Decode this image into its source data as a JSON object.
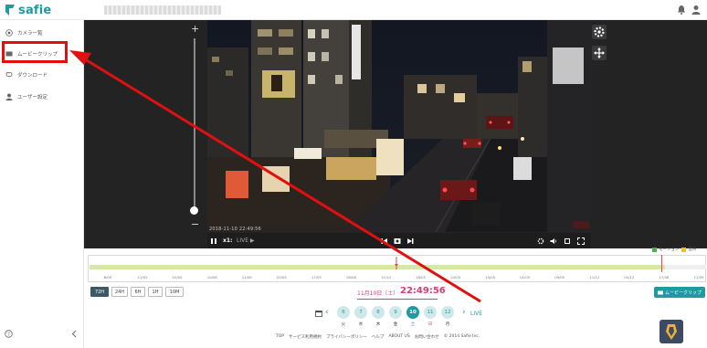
{
  "header": {
    "logo_text": "safie",
    "brand_color": "#1e9aa0"
  },
  "sidebar": {
    "items": [
      {
        "label": "カメラ一覧",
        "icon": "camera-icon"
      },
      {
        "label": "ムービークリップ",
        "icon": "film-icon"
      },
      {
        "label": "ダウンロード",
        "icon": "download-icon"
      },
      {
        "label": "ユーザー設定",
        "icon": "user-icon"
      }
    ],
    "highlight_color": "#e01010"
  },
  "player": {
    "timestamp": "2018-11-10 22:49:56",
    "speed_label": "x1:",
    "live_label": "LIVE ▶",
    "zoom_plus": "+",
    "zoom_minus": "−"
  },
  "timeline": {
    "legend": [
      {
        "label": "モーション",
        "color": "#4caf50"
      },
      {
        "label": "音声",
        "color": "#f0c020"
      }
    ],
    "ticks": [
      "8/09",
      "11/02",
      "10/05",
      "10/08",
      "11/09",
      "20/05",
      "17/05",
      "16/08",
      "11/10",
      "18/05",
      "10/05",
      "14/05",
      "01/05",
      "09/05",
      "11/12",
      "04/12",
      "17/08",
      "11/09"
    ],
    "range_buttons": [
      "72H",
      "24H",
      "6H",
      "1H",
      "10M"
    ],
    "active_range": "72H",
    "current_date": "11月10日（土）",
    "current_time": "22:49:56",
    "clip_button": "ムービークリップ"
  },
  "dates": {
    "days": [
      {
        "num": "6",
        "wd": "火"
      },
      {
        "num": "7",
        "wd": "水"
      },
      {
        "num": "8",
        "wd": "木"
      },
      {
        "num": "9",
        "wd": "金"
      },
      {
        "num": "10",
        "wd": "土"
      },
      {
        "num": "11",
        "wd": "日"
      },
      {
        "num": "12",
        "wd": "月"
      }
    ],
    "selected": "10",
    "live_label": "LIVE"
  },
  "footer": {
    "links": [
      "TOP",
      "サービス利用規約",
      "プライバシーポリシー",
      "ヘルプ",
      "ABOUT US",
      "お問い合わせ",
      "© 2014 Safie Inc."
    ]
  }
}
